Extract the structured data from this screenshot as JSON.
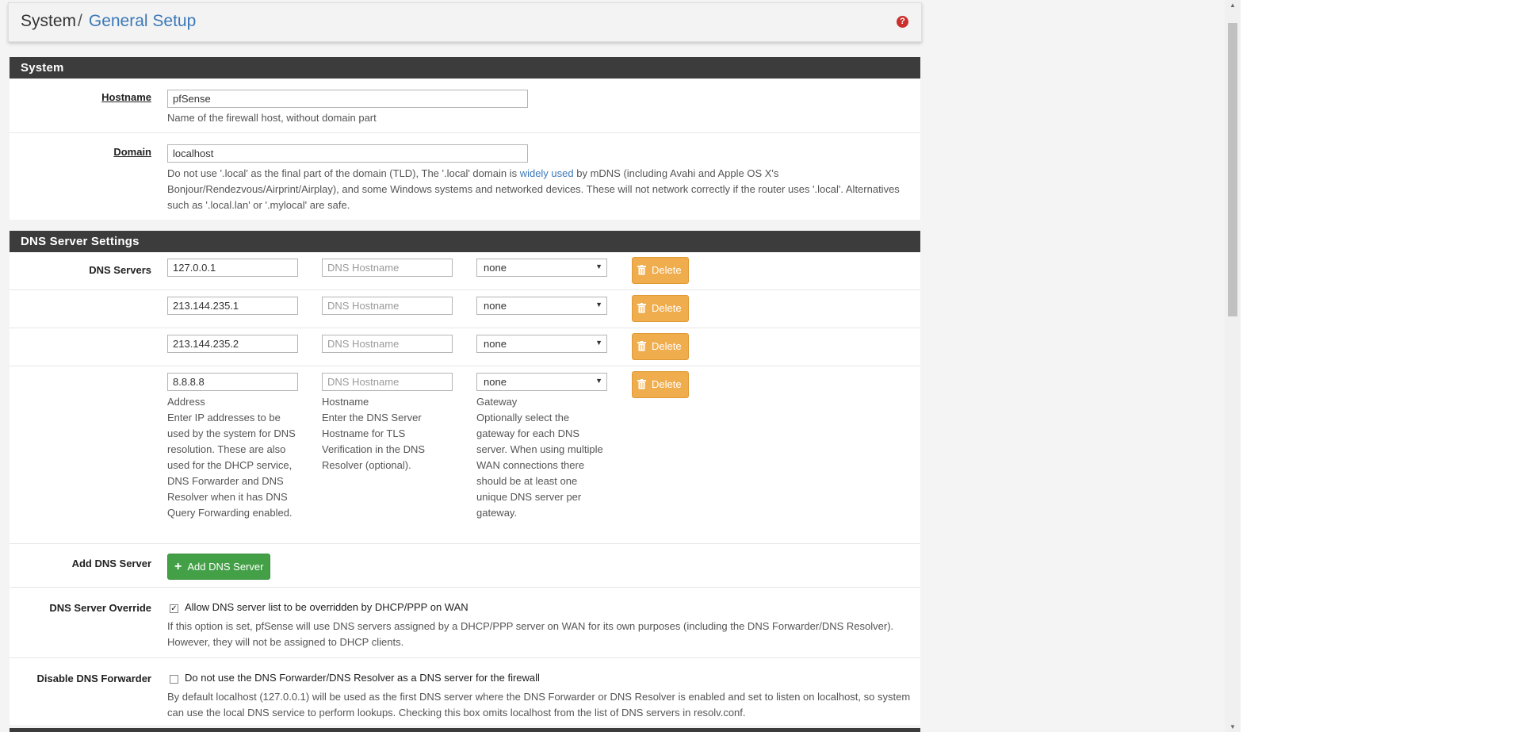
{
  "breadcrumb": {
    "parent": "System",
    "separator": "/",
    "current": "General Setup"
  },
  "header": {
    "help_icon": "question-circle-icon",
    "help_glyph": "?"
  },
  "system_section": {
    "title": "System",
    "hostname": {
      "label": "Hostname",
      "value": "pfSense",
      "help": "Name of the firewall host, without domain part"
    },
    "domain": {
      "label": "Domain",
      "value": "localhost",
      "help_before": "Do not use '.local' as the final part of the domain (TLD), The '.local' domain is ",
      "help_link": "widely used",
      "help_after": " by mDNS (including Avahi and Apple OS X's Bonjour/Rendezvous/Airprint/Airplay), and some Windows systems and networked devices. These will not network correctly if the router uses '.local'. Alternatives such as '.local.lan' or '.mylocal' are safe."
    }
  },
  "dns_section": {
    "title": "DNS Server Settings",
    "servers_label": "DNS Servers",
    "hostname_placeholder": "DNS Hostname",
    "delete_label": "Delete",
    "servers": [
      {
        "address": "127.0.0.1",
        "hostname": "",
        "gateway": "none"
      },
      {
        "address": "213.144.235.1",
        "hostname": "",
        "gateway": "none"
      },
      {
        "address": "213.144.235.2",
        "hostname": "",
        "gateway": "none"
      },
      {
        "address": "8.8.8.8",
        "hostname": "",
        "gateway": "none"
      }
    ],
    "column_help": {
      "address_title": "Address",
      "address_text": "Enter IP addresses to be used by the system for DNS resolution. These are also used for the DHCP service, DNS Forwarder and DNS Resolver when it has DNS Query Forwarding enabled.",
      "hostname_title": "Hostname",
      "hostname_text": "Enter the DNS Server Hostname for TLS Verification in the DNS Resolver (optional).",
      "gateway_title": "Gateway",
      "gateway_text": "Optionally select the gateway for each DNS server. When using multiple WAN connections there should be at least one unique DNS server per gateway."
    },
    "add_label": "Add DNS Server",
    "add_button": "Add DNS Server",
    "override": {
      "label": "DNS Server Override",
      "checked": true,
      "check_mark": "✓",
      "checkbox_text": "Allow DNS server list to be overridden by DHCP/PPP on WAN",
      "help": "If this option is set, pfSense will use DNS servers assigned by a DHCP/PPP server on WAN for its own purposes (including the DNS Forwarder/DNS Resolver). However, they will not be assigned to DHCP clients."
    },
    "disable_forwarder": {
      "label": "Disable DNS Forwarder",
      "checked": false,
      "checkbox_text": "Do not use the DNS Forwarder/DNS Resolver as a DNS server for the firewall",
      "help": "By default localhost (127.0.0.1) will be used as the first DNS server where the DNS Forwarder or DNS Resolver is enabled and set to listen on localhost, so system can use the local DNS service to perform lookups. Checking this box omits localhost from the list of DNS servers in resolv.conf."
    }
  },
  "colors": {
    "panel_heading": "#3c3c3c",
    "link": "#3c78b8",
    "delete_button": "#f0ad4e",
    "add_button": "#43a047",
    "help_icon": "#c9302c"
  }
}
